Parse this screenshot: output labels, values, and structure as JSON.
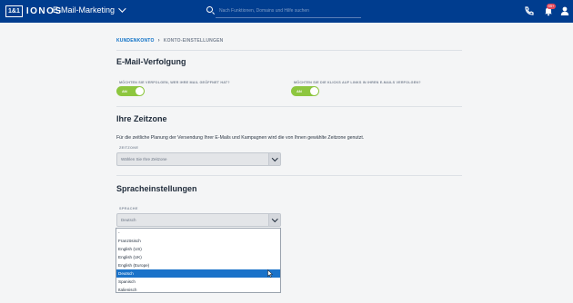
{
  "header": {
    "logo_box": "1&1",
    "logo_text": "IONOS",
    "app_name": "E-Mail-Marketing",
    "search_placeholder": "Nach Funktionen, Domains und Hilfe suchen",
    "notification_count": "99+",
    "brand_color": "#003d8f"
  },
  "breadcrumb": {
    "parent": "KUNDENKONTO",
    "current": "KONTO-EINSTELLUNGEN"
  },
  "tracking": {
    "title": "E-Mail-Verfolgung",
    "open_label": "MÖCHTEN SIE VERFOLGEN, WER IHRE MAIL GEÖFFNET HAT?",
    "open_state": "AN",
    "click_label": "MÖCHTEN SIE DIE KLICKS AUF LINKS IN IHREN E-MAILS VERFOLGEN?",
    "click_state": "AN",
    "toggle_color": "#8dc63f"
  },
  "timezone": {
    "title": "Ihre Zeitzone",
    "description": "Für die zeitliche Planung der Versendung Ihrer E-Mails und Kampagnen wird die von Ihnen gewählte Zeitzone genutzt.",
    "field_label": "ZEITZONE",
    "placeholder": "Wählen Sie Ihre Zeitzone"
  },
  "language": {
    "title": "Spracheinstellungen",
    "field_label": "SPRACHE",
    "selected": "Deutsch",
    "options": [
      "-",
      "Französisch",
      "English (US)",
      "English (UK)",
      "English (Europe)",
      "Deutsch",
      "Spanisch",
      "Italienisch"
    ],
    "selected_index": 5,
    "highlight_color": "#1a72c9"
  }
}
